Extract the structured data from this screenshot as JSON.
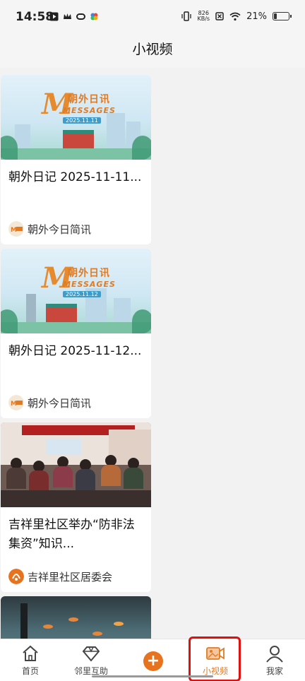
{
  "status": {
    "time": "14:58",
    "net_speed_value": "826",
    "net_speed_unit": "KB/s",
    "battery": "21%",
    "battery_level": 0.21
  },
  "header": {
    "title": "小视频"
  },
  "feed": {
    "cards": [
      {
        "title": "朝外日记 2025-11-11...",
        "source": "朝外今日简讯",
        "thumb_text": {
          "badge": "朝外日讯",
          "word": "MESSAGES",
          "date": "2025.11.11"
        }
      },
      {
        "title": "朝外日记 2025-11-12...",
        "source": "朝外今日简讯",
        "thumb_text": {
          "badge": "朝外日讯",
          "word": "MESSAGES",
          "date": "2025.11.12"
        }
      },
      {
        "title": "吉祥里社区举办“防非法集资”知识...",
        "source": "吉祥里社区居委会"
      }
    ]
  },
  "tabbar": {
    "tabs": [
      {
        "label": "首页",
        "icon": "home-icon"
      },
      {
        "label": "邻里互助",
        "icon": "diamond-icon"
      },
      {
        "label": "",
        "icon": "plus-icon"
      },
      {
        "label": "小视频",
        "icon": "video-icon"
      },
      {
        "label": "我家",
        "icon": "user-icon"
      }
    ],
    "active": "小视频",
    "accent_color": "#e07b24"
  }
}
